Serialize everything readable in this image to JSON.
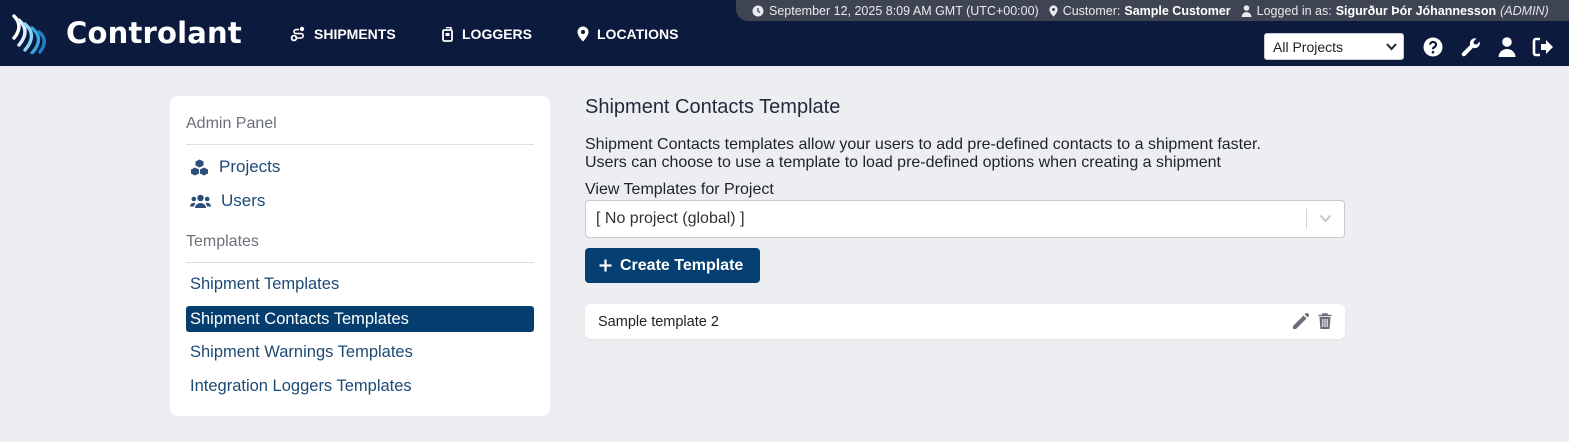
{
  "brand": {
    "name": "Controlant",
    "icon": "controlant-logo-icon"
  },
  "nav": [
    {
      "label": "SHIPMENTS",
      "icon": "shipments-route-icon"
    },
    {
      "label": "LOGGERS",
      "icon": "logger-device-icon"
    },
    {
      "label": "LOCATIONS",
      "icon": "map-pin-icon"
    }
  ],
  "status": {
    "datetime": "September 12, 2025 8:09 AM GMT (UTC+00:00)",
    "customer_label": "Customer:",
    "customer": "Sample Customer",
    "logged_label": "Logged in as:",
    "user": "Sigurður Þór Jóhannesson",
    "role": "(ADMIN)"
  },
  "project_select": {
    "value": "All Projects"
  },
  "header_icons": [
    "help-icon",
    "wrench-icon",
    "user-icon",
    "logout-icon"
  ],
  "sidebar": {
    "admin_title": "Admin Panel",
    "admin_items": [
      {
        "label": "Projects",
        "icon": "cubes-icon"
      },
      {
        "label": "Users",
        "icon": "users-icon"
      }
    ],
    "templates_title": "Templates",
    "template_items": [
      {
        "label": "Shipment Templates",
        "active": false
      },
      {
        "label": "Shipment Contacts Templates",
        "active": true
      },
      {
        "label": "Shipment Warnings Templates",
        "active": false
      },
      {
        "label": "Integration Loggers Templates",
        "active": false
      }
    ]
  },
  "main": {
    "title": "Shipment Contacts Template",
    "description_line1": "Shipment Contacts templates allow your users to add pre-defined contacts to a shipment faster.",
    "description_line2": "Users can choose to use a template to load pre-defined options when creating a shipment",
    "view_label": "View Templates for Project",
    "project_value": "[ No project (global) ]",
    "create_label": "Create Template",
    "templates": [
      {
        "name": "Sample template 2"
      }
    ]
  },
  "colors": {
    "header_bg": "#0b1a3d",
    "status_bar_bg": "#3f4452",
    "accent": "#063f72",
    "link": "#1d4a75",
    "page_bg": "#eceef1"
  }
}
